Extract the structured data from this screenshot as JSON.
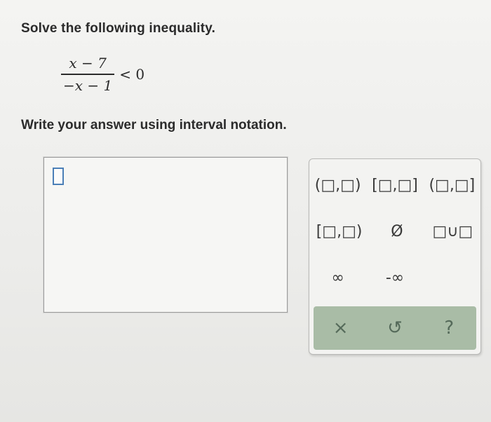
{
  "question": {
    "prompt": "Solve the following inequality.",
    "numerator": "x − 7",
    "denominator": "−x − 1",
    "relation": "< 0",
    "instruction": "Write your answer using interval notation."
  },
  "palette": {
    "row1": [
      "(□,□)",
      "[□,□]",
      "(□,□]"
    ],
    "row2": [
      "[□,□)",
      "Ø",
      "□∪□"
    ],
    "row3": [
      "∞",
      "-∞"
    ],
    "actions": {
      "clear": "×",
      "undo": "↺",
      "help": "?"
    }
  }
}
